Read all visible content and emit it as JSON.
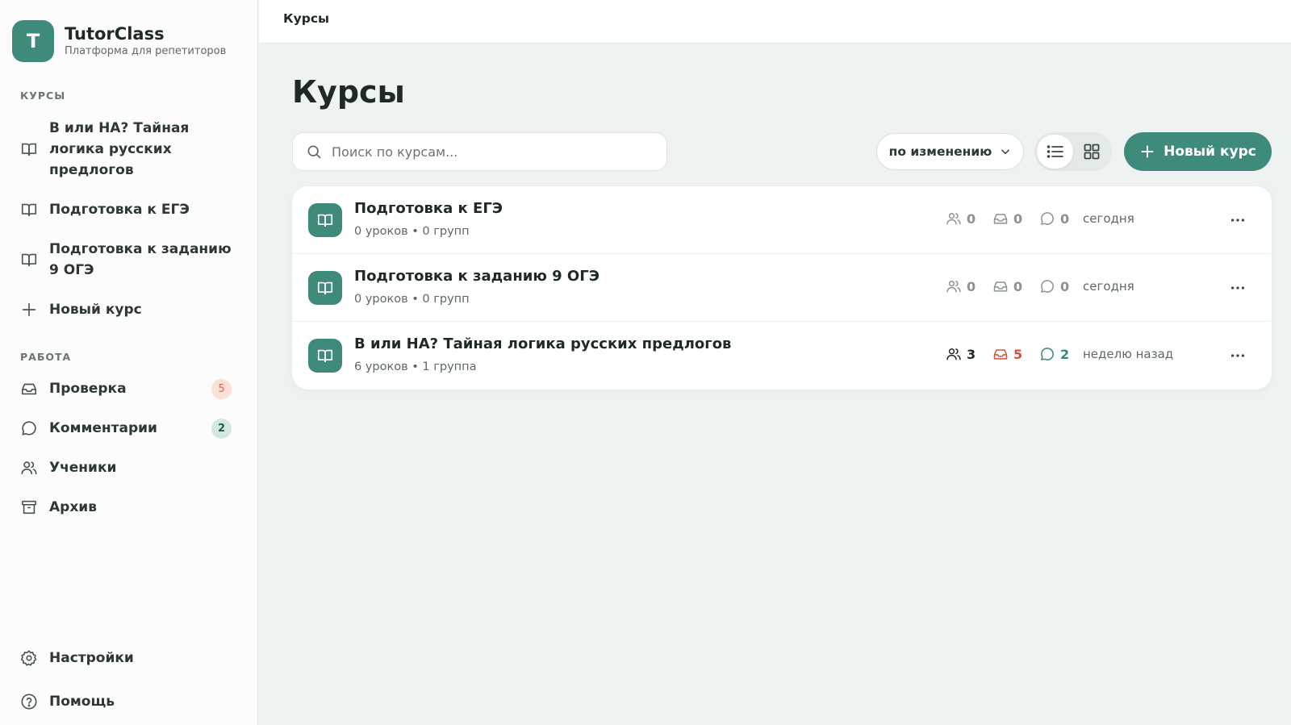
{
  "brand": {
    "logo_letter": "T",
    "name": "TutorClass",
    "subtitle": "Платформа для репетиторов"
  },
  "sidebar": {
    "courses_label": "КУРСЫ",
    "courses": [
      {
        "label": "В или НА? Тайная логика русских предлогов",
        "icon": "book-icon"
      },
      {
        "label": "Подготовка к ЕГЭ",
        "icon": "book-icon"
      },
      {
        "label": "Подготовка к заданию 9 ОГЭ",
        "icon": "book-icon"
      }
    ],
    "new_course": "Новый курс",
    "work_label": "РАБОТА",
    "work": [
      {
        "label": "Проверка",
        "icon": "inbox-icon",
        "badge": "5"
      },
      {
        "label": "Комментарии",
        "icon": "comment-icon",
        "badge": "2"
      },
      {
        "label": "Ученики",
        "icon": "users-icon"
      },
      {
        "label": "Архив",
        "icon": "archive-icon"
      }
    ],
    "settings": "Настройки",
    "help": "Помощь"
  },
  "header": {
    "breadcrumb": "Курсы"
  },
  "main": {
    "title": "Курсы",
    "search_placeholder": "Поиск по курсам...",
    "sort_label": "по изменению",
    "new_course_button": "Новый курс",
    "courses": [
      {
        "title": "Подготовка к ЕГЭ",
        "meta": "0 уроков • 0 групп",
        "students": "0",
        "submissions": "0",
        "comments": "0",
        "updated": "сегодня"
      },
      {
        "title": "Подготовка к заданию 9 ОГЭ",
        "meta": "0 уроков • 0 групп",
        "students": "0",
        "submissions": "0",
        "comments": "0",
        "updated": "сегодня"
      },
      {
        "title": "В или НА? Тайная логика русских предлогов",
        "meta": "6 уроков • 1 группа",
        "students": "3",
        "submissions": "5",
        "comments": "2",
        "updated": "неделю назад"
      }
    ]
  },
  "colors": {
    "accent": "#3f8b7b",
    "danger": "#d1533a",
    "badge_red_bg": "#fbe0d8",
    "badge_green_bg": "#d3e8e1"
  }
}
